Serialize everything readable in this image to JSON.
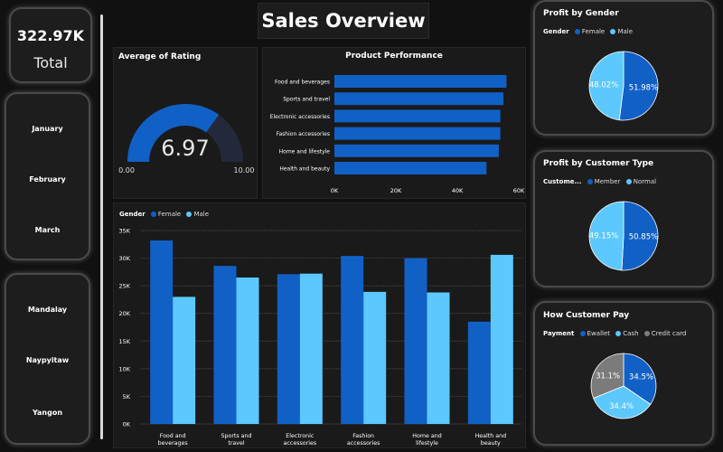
{
  "kpi": {
    "value": "322.97K",
    "label": "Total"
  },
  "slicers": {
    "months": [
      "January",
      "February",
      "March"
    ],
    "cities": [
      "Mandalay",
      "Naypyitaw",
      "Yangon"
    ]
  },
  "header": {
    "title": "Sales Overview"
  },
  "colors": {
    "dark_blue": "#1160c6",
    "light_blue": "#5cc8fd",
    "gray": "#7b7b7b",
    "gauge_track": "#23283a"
  },
  "gauge": {
    "title": "Average of Rating",
    "value": 6.97,
    "value_label": "6.97",
    "min_label": "0.00",
    "max_label": "10.00",
    "min": 0,
    "max": 10
  },
  "legends": {
    "gender": {
      "label": "Gender",
      "female": "Female",
      "male": "Male"
    },
    "customer": {
      "label": "Custome...",
      "member": "Member",
      "normal": "Normal"
    },
    "payment": {
      "label": "Payment",
      "ewallet": "Ewallet",
      "cash": "Cash",
      "credit": "Credit card"
    }
  },
  "chart_data": [
    {
      "type": "bar",
      "orientation": "horizontal",
      "title": "Product Performance",
      "categories": [
        "Food and beverages",
        "Sports and travel",
        "Electronic accessories",
        "Fashion accessories",
        "Home and lifestyle",
        "Health and beauty"
      ],
      "values": [
        56000,
        55000,
        54000,
        54000,
        53500,
        49500
      ],
      "xticks": [
        "0K",
        "20K",
        "40K",
        "60K"
      ],
      "xlim": [
        0,
        60000
      ],
      "color": "#1160c6"
    },
    {
      "type": "bar",
      "title": "",
      "categories": [
        "Food and beverages",
        "Sports and travel",
        "Electronic accessories",
        "Fashion accessories",
        "Home and lifestyle",
        "Health and beauty"
      ],
      "series": [
        {
          "name": "Female",
          "values": [
            33200,
            28600,
            27100,
            30400,
            30000,
            18500
          ],
          "color": "#1160c6"
        },
        {
          "name": "Male",
          "values": [
            23000,
            26500,
            27200,
            23900,
            23800,
            30600
          ],
          "color": "#5cc8fd"
        }
      ],
      "yticks": [
        "0K",
        "5K",
        "10K",
        "15K",
        "20K",
        "25K",
        "30K",
        "35K"
      ],
      "ylim": [
        0,
        35000
      ],
      "legend": "top-left"
    },
    {
      "type": "pie",
      "title": "Profit by Gender",
      "labels": [
        "Female",
        "Male"
      ],
      "values": [
        51.98,
        48.02
      ],
      "value_labels": [
        "51.98%",
        "48.02%"
      ],
      "colors": [
        "#1160c6",
        "#5cc8fd"
      ]
    },
    {
      "type": "pie",
      "title": "Profit by Customer Type",
      "labels": [
        "Member",
        "Normal"
      ],
      "values": [
        50.85,
        49.15
      ],
      "value_labels": [
        "50.85%",
        "49.15%"
      ],
      "colors": [
        "#1160c6",
        "#5cc8fd"
      ]
    },
    {
      "type": "pie",
      "title": "How Customer Pay",
      "labels": [
        "Ewallet",
        "Cash",
        "Credit card"
      ],
      "values": [
        34.5,
        34.4,
        31.1
      ],
      "value_labels": [
        "34.5%",
        "34.4%",
        "31.1%"
      ],
      "colors": [
        "#1160c6",
        "#5cc8fd",
        "#7b7b7b"
      ]
    }
  ]
}
